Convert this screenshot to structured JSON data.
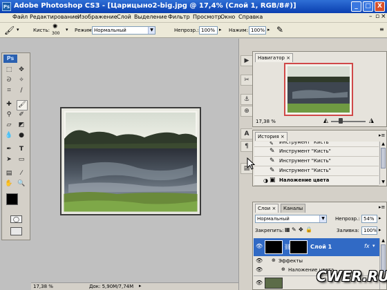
{
  "window": {
    "app_icon": "Ps",
    "title": "Adobe Photoshop CS3 - [Царицыно2-big.jpg @ 17,4% (Слой 1, RGB/8#)]",
    "btn_minimize": "_",
    "btn_maximize": "□",
    "btn_close": "X"
  },
  "menu": [
    "Файл",
    "Редактирование",
    "Изображение",
    "Слой",
    "Выделение",
    "Фильтр",
    "Просмотр",
    "Окно",
    "Справка"
  ],
  "options": {
    "brush_label": "Кисть:",
    "brush_size": "300",
    "mode_label": "Режим:",
    "mode_value": "Нормальный",
    "opacity_label": "Непрозр.:",
    "opacity_value": "100%",
    "flow_label": "Нажим:",
    "flow_value": "100%"
  },
  "toolbox": {
    "logo": "Ps"
  },
  "status": {
    "zoom": "17,38 %",
    "doc_info": "Док: 5,90M/7,74M"
  },
  "navigator": {
    "tab": "Навигатор",
    "zoom": "17,38 %"
  },
  "history": {
    "tab": "История",
    "rows": [
      "Инструмент \"Кисть\"",
      "Инструмент \"Кисть\"",
      "Инструмент \"Кисть\"",
      "Инструмент \"Кисть\"",
      "Наложение цвета"
    ]
  },
  "layers": {
    "tab_layers": "Слои",
    "tab_channels": "Каналы",
    "blend_mode": "Нормальный",
    "opacity_label": "Непрозр.:",
    "opacity_value": "54%",
    "lock_label": "Закрепить:",
    "fill_label": "Заливка:",
    "fill_value": "100%",
    "layer_name": "Слой 1",
    "fx": "fx",
    "effects_label": "Эффекты",
    "effect_name": "Наложение цвета"
  },
  "watermark": "CWER.RU",
  "colors": {
    "title_bar": "#0a3fb0",
    "menu_bg": "#ece9d8",
    "selected_layer": "#316ac5",
    "navigator_frame": "#d04848"
  }
}
